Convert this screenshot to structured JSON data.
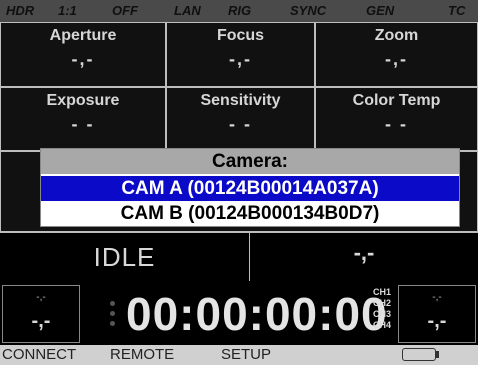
{
  "status_bar": {
    "items": [
      "HDR",
      "1:1",
      "OFF",
      "LAN",
      "RIG",
      "SYNC",
      "GEN",
      "TC"
    ]
  },
  "params": {
    "aperture": {
      "label": "Aperture",
      "value": "-,-"
    },
    "focus": {
      "label": "Focus",
      "value": "-,-"
    },
    "zoom": {
      "label": "Zoom",
      "value": "-,-"
    },
    "exposure": {
      "label": "Exposure",
      "value": "- -"
    },
    "sensitivity": {
      "label": "Sensitivity",
      "value": "- -"
    },
    "color_temp": {
      "label": "Color Temp",
      "value": "- -"
    }
  },
  "camera_dialog": {
    "title": "Camera:",
    "options": [
      {
        "label": "CAM A (00124B00014A037A)",
        "selected": true
      },
      {
        "label": "CAM B (00124B000134B0D7)",
        "selected": false
      }
    ]
  },
  "state": {
    "label": "IDLE",
    "value": "-,-"
  },
  "timecode": {
    "value": "00:00:00:00",
    "left_small": "-,-",
    "left_big": "-,-",
    "right_small": "-,-",
    "right_big": "-,-",
    "channels": [
      "CH1",
      "CH2",
      "CH3",
      "CH4"
    ]
  },
  "menu": {
    "items": [
      "CONNECT",
      "REMOTE",
      "SETUP"
    ]
  },
  "icons": {
    "battery": "battery-icon"
  },
  "colors": {
    "selection": "#0a0ac8",
    "dialog_title_bg": "#a8a8a8",
    "status_bg": "#4a4a4a",
    "menu_bg": "#d0d0d0"
  }
}
